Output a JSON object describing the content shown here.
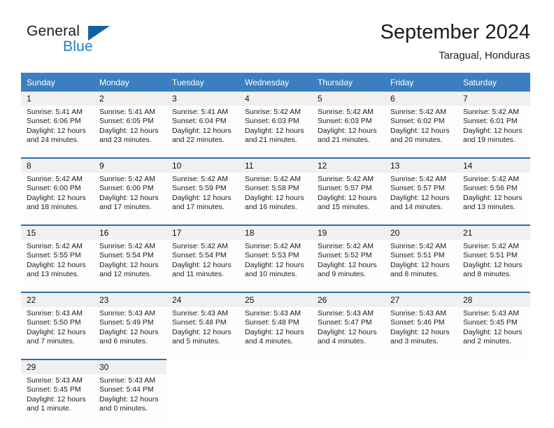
{
  "brand": {
    "word_general": "General",
    "word_blue": "Blue",
    "flag_icon": "triangle-flag-icon"
  },
  "header": {
    "month_title": "September 2024",
    "location": "Taragual, Honduras"
  },
  "colors": {
    "header_blue": "#3c7fc1",
    "week_divider_blue": "#2f6fad",
    "daynum_band": "#f0f0f0",
    "brand_blue": "#1f7ac4",
    "brand_flag": "#14619e"
  },
  "calendar": {
    "weekday_headers": [
      "Sunday",
      "Monday",
      "Tuesday",
      "Wednesday",
      "Thursday",
      "Friday",
      "Saturday"
    ],
    "weeks": [
      {
        "days": [
          {
            "num": "1",
            "sunrise": "Sunrise: 5:41 AM",
            "sunset": "Sunset: 6:06 PM",
            "daylight_1": "Daylight: 12 hours",
            "daylight_2": "and 24 minutes."
          },
          {
            "num": "2",
            "sunrise": "Sunrise: 5:41 AM",
            "sunset": "Sunset: 6:05 PM",
            "daylight_1": "Daylight: 12 hours",
            "daylight_2": "and 23 minutes."
          },
          {
            "num": "3",
            "sunrise": "Sunrise: 5:41 AM",
            "sunset": "Sunset: 6:04 PM",
            "daylight_1": "Daylight: 12 hours",
            "daylight_2": "and 22 minutes."
          },
          {
            "num": "4",
            "sunrise": "Sunrise: 5:42 AM",
            "sunset": "Sunset: 6:03 PM",
            "daylight_1": "Daylight: 12 hours",
            "daylight_2": "and 21 minutes."
          },
          {
            "num": "5",
            "sunrise": "Sunrise: 5:42 AM",
            "sunset": "Sunset: 6:03 PM",
            "daylight_1": "Daylight: 12 hours",
            "daylight_2": "and 21 minutes."
          },
          {
            "num": "6",
            "sunrise": "Sunrise: 5:42 AM",
            "sunset": "Sunset: 6:02 PM",
            "daylight_1": "Daylight: 12 hours",
            "daylight_2": "and 20 minutes."
          },
          {
            "num": "7",
            "sunrise": "Sunrise: 5:42 AM",
            "sunset": "Sunset: 6:01 PM",
            "daylight_1": "Daylight: 12 hours",
            "daylight_2": "and 19 minutes."
          }
        ]
      },
      {
        "days": [
          {
            "num": "8",
            "sunrise": "Sunrise: 5:42 AM",
            "sunset": "Sunset: 6:00 PM",
            "daylight_1": "Daylight: 12 hours",
            "daylight_2": "and 18 minutes."
          },
          {
            "num": "9",
            "sunrise": "Sunrise: 5:42 AM",
            "sunset": "Sunset: 6:00 PM",
            "daylight_1": "Daylight: 12 hours",
            "daylight_2": "and 17 minutes."
          },
          {
            "num": "10",
            "sunrise": "Sunrise: 5:42 AM",
            "sunset": "Sunset: 5:59 PM",
            "daylight_1": "Daylight: 12 hours",
            "daylight_2": "and 17 minutes."
          },
          {
            "num": "11",
            "sunrise": "Sunrise: 5:42 AM",
            "sunset": "Sunset: 5:58 PM",
            "daylight_1": "Daylight: 12 hours",
            "daylight_2": "and 16 minutes."
          },
          {
            "num": "12",
            "sunrise": "Sunrise: 5:42 AM",
            "sunset": "Sunset: 5:57 PM",
            "daylight_1": "Daylight: 12 hours",
            "daylight_2": "and 15 minutes."
          },
          {
            "num": "13",
            "sunrise": "Sunrise: 5:42 AM",
            "sunset": "Sunset: 5:57 PM",
            "daylight_1": "Daylight: 12 hours",
            "daylight_2": "and 14 minutes."
          },
          {
            "num": "14",
            "sunrise": "Sunrise: 5:42 AM",
            "sunset": "Sunset: 5:56 PM",
            "daylight_1": "Daylight: 12 hours",
            "daylight_2": "and 13 minutes."
          }
        ]
      },
      {
        "days": [
          {
            "num": "15",
            "sunrise": "Sunrise: 5:42 AM",
            "sunset": "Sunset: 5:55 PM",
            "daylight_1": "Daylight: 12 hours",
            "daylight_2": "and 13 minutes."
          },
          {
            "num": "16",
            "sunrise": "Sunrise: 5:42 AM",
            "sunset": "Sunset: 5:54 PM",
            "daylight_1": "Daylight: 12 hours",
            "daylight_2": "and 12 minutes."
          },
          {
            "num": "17",
            "sunrise": "Sunrise: 5:42 AM",
            "sunset": "Sunset: 5:54 PM",
            "daylight_1": "Daylight: 12 hours",
            "daylight_2": "and 11 minutes."
          },
          {
            "num": "18",
            "sunrise": "Sunrise: 5:42 AM",
            "sunset": "Sunset: 5:53 PM",
            "daylight_1": "Daylight: 12 hours",
            "daylight_2": "and 10 minutes."
          },
          {
            "num": "19",
            "sunrise": "Sunrise: 5:42 AM",
            "sunset": "Sunset: 5:52 PM",
            "daylight_1": "Daylight: 12 hours",
            "daylight_2": "and 9 minutes."
          },
          {
            "num": "20",
            "sunrise": "Sunrise: 5:42 AM",
            "sunset": "Sunset: 5:51 PM",
            "daylight_1": "Daylight: 12 hours",
            "daylight_2": "and 8 minutes."
          },
          {
            "num": "21",
            "sunrise": "Sunrise: 5:42 AM",
            "sunset": "Sunset: 5:51 PM",
            "daylight_1": "Daylight: 12 hours",
            "daylight_2": "and 8 minutes."
          }
        ]
      },
      {
        "days": [
          {
            "num": "22",
            "sunrise": "Sunrise: 5:43 AM",
            "sunset": "Sunset: 5:50 PM",
            "daylight_1": "Daylight: 12 hours",
            "daylight_2": "and 7 minutes."
          },
          {
            "num": "23",
            "sunrise": "Sunrise: 5:43 AM",
            "sunset": "Sunset: 5:49 PM",
            "daylight_1": "Daylight: 12 hours",
            "daylight_2": "and 6 minutes."
          },
          {
            "num": "24",
            "sunrise": "Sunrise: 5:43 AM",
            "sunset": "Sunset: 5:48 PM",
            "daylight_1": "Daylight: 12 hours",
            "daylight_2": "and 5 minutes."
          },
          {
            "num": "25",
            "sunrise": "Sunrise: 5:43 AM",
            "sunset": "Sunset: 5:48 PM",
            "daylight_1": "Daylight: 12 hours",
            "daylight_2": "and 4 minutes."
          },
          {
            "num": "26",
            "sunrise": "Sunrise: 5:43 AM",
            "sunset": "Sunset: 5:47 PM",
            "daylight_1": "Daylight: 12 hours",
            "daylight_2": "and 4 minutes."
          },
          {
            "num": "27",
            "sunrise": "Sunrise: 5:43 AM",
            "sunset": "Sunset: 5:46 PM",
            "daylight_1": "Daylight: 12 hours",
            "daylight_2": "and 3 minutes."
          },
          {
            "num": "28",
            "sunrise": "Sunrise: 5:43 AM",
            "sunset": "Sunset: 5:45 PM",
            "daylight_1": "Daylight: 12 hours",
            "daylight_2": "and 2 minutes."
          }
        ]
      },
      {
        "days": [
          {
            "num": "29",
            "sunrise": "Sunrise: 5:43 AM",
            "sunset": "Sunset: 5:45 PM",
            "daylight_1": "Daylight: 12 hours",
            "daylight_2": "and 1 minute."
          },
          {
            "num": "30",
            "sunrise": "Sunrise: 5:43 AM",
            "sunset": "Sunset: 5:44 PM",
            "daylight_1": "Daylight: 12 hours",
            "daylight_2": "and 0 minutes."
          },
          {
            "num": "",
            "sunrise": "",
            "sunset": "",
            "daylight_1": "",
            "daylight_2": ""
          },
          {
            "num": "",
            "sunrise": "",
            "sunset": "",
            "daylight_1": "",
            "daylight_2": ""
          },
          {
            "num": "",
            "sunrise": "",
            "sunset": "",
            "daylight_1": "",
            "daylight_2": ""
          },
          {
            "num": "",
            "sunrise": "",
            "sunset": "",
            "daylight_1": "",
            "daylight_2": ""
          },
          {
            "num": "",
            "sunrise": "",
            "sunset": "",
            "daylight_1": "",
            "daylight_2": ""
          }
        ]
      }
    ]
  }
}
